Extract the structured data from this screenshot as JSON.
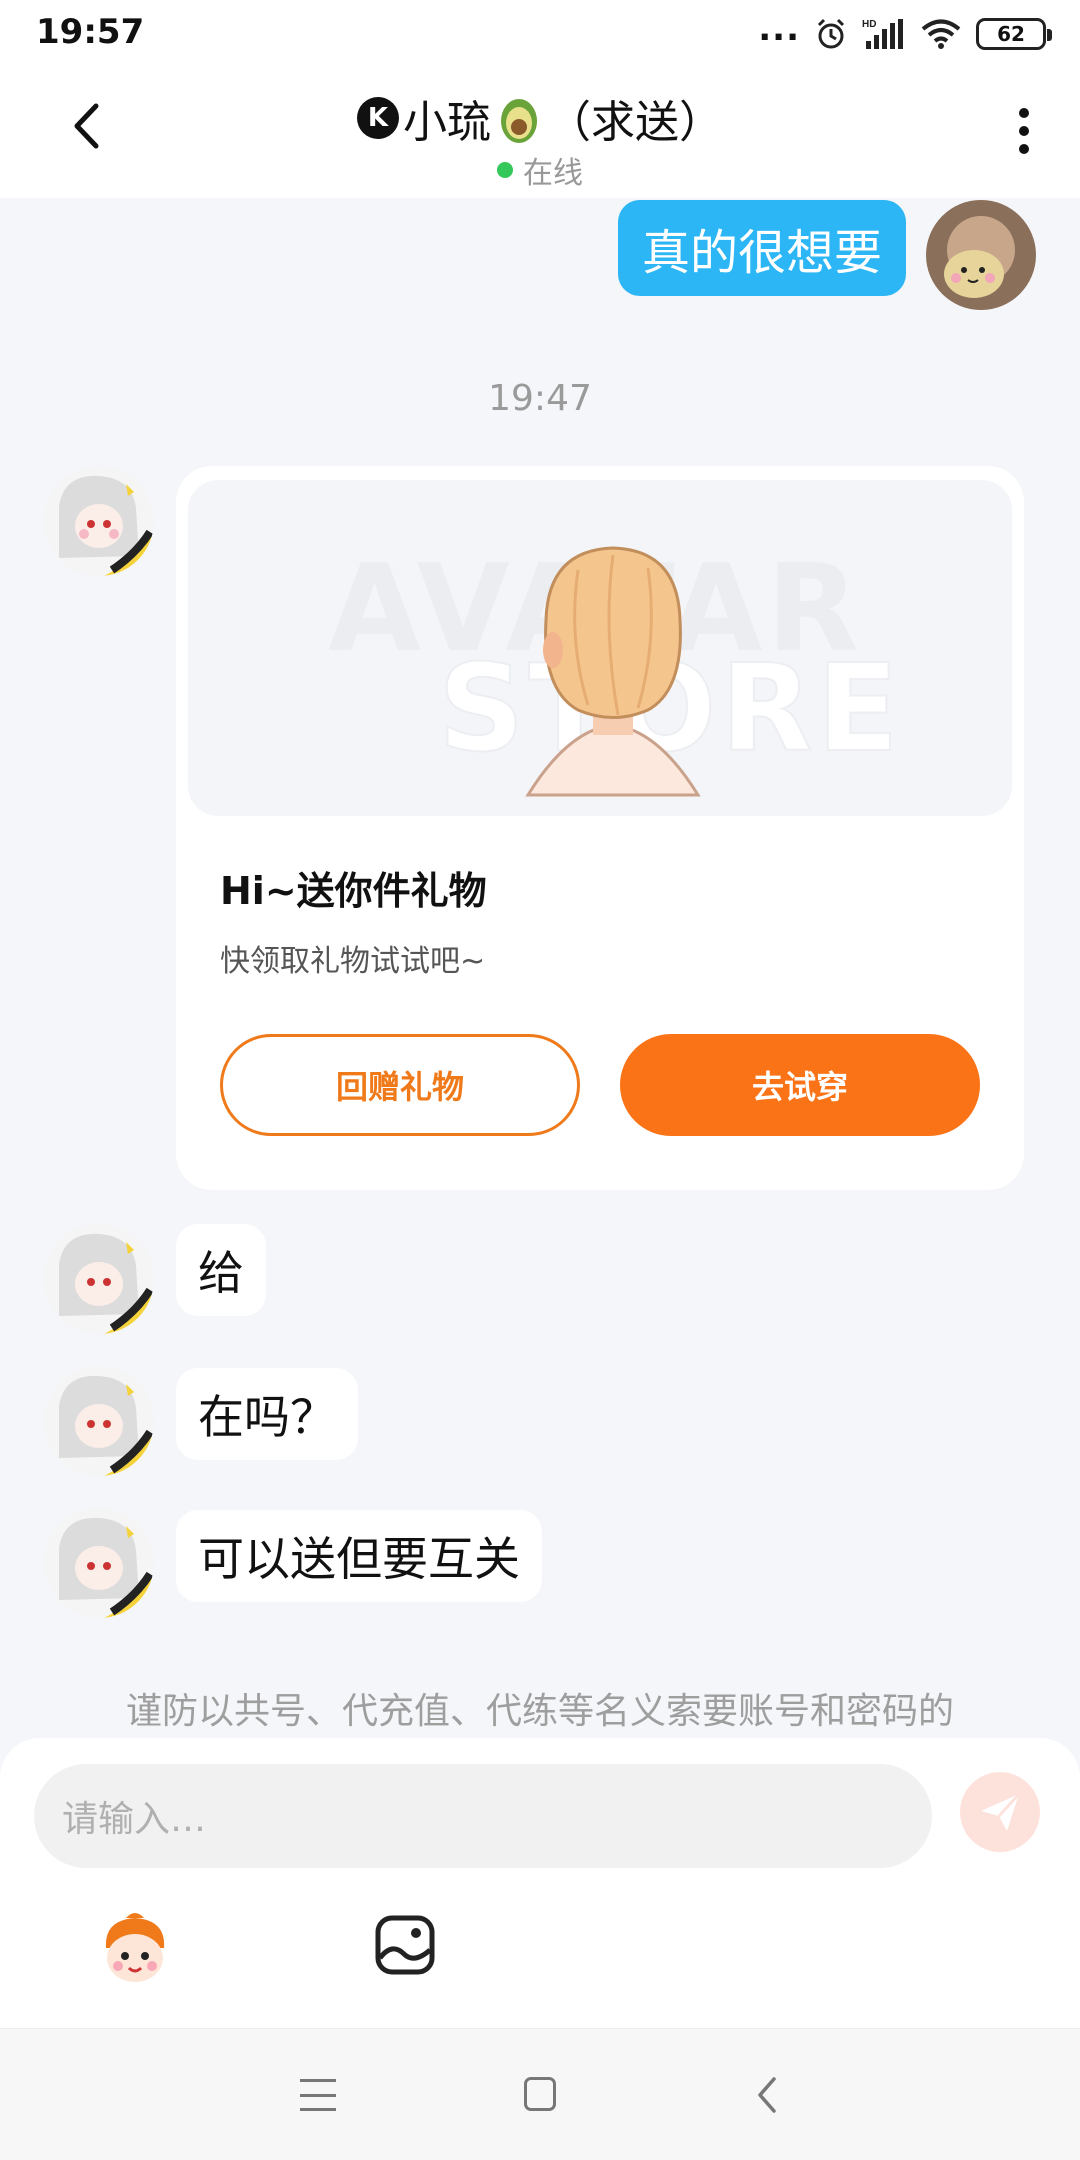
{
  "status_bar": {
    "time": "19:57",
    "dots": "...",
    "battery": "62"
  },
  "header": {
    "badge": "K",
    "title": "小琉",
    "title_suffix": "（求送）",
    "status": "在线"
  },
  "messages": {
    "outgoing_1": "真的很想要",
    "timestamp": "19:47",
    "gift_card": {
      "watermark_1": "AVATAR",
      "watermark_2": "STORE",
      "title": "Hi~送你件礼物",
      "subtitle": "快领取礼物试试吧~",
      "return_label": "回赠礼物",
      "try_label": "去试穿"
    },
    "incoming": [
      "给",
      "在吗？",
      "可以送但要互关"
    ]
  },
  "notice": "谨防以共号、代充值、代练等名义索要账号和密码的",
  "composer": {
    "placeholder": "请输入…"
  },
  "colors": {
    "accent_orange": "#fb7317",
    "bubble_blue": "#2db6f5",
    "online_green": "#34c759"
  }
}
